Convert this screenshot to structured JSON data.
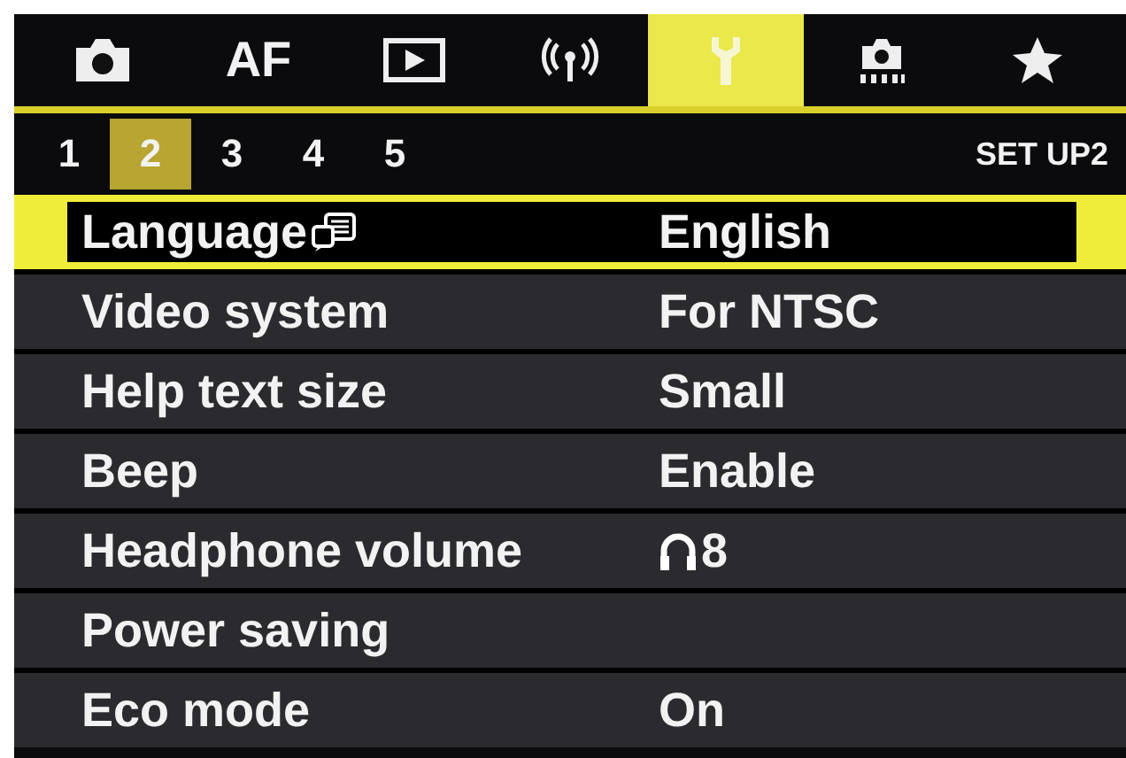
{
  "tabs": [
    {
      "kind": "camera",
      "selected": false
    },
    {
      "kind": "text",
      "label": "AF",
      "selected": false
    },
    {
      "kind": "play",
      "selected": false
    },
    {
      "kind": "wireless",
      "selected": false
    },
    {
      "kind": "wrench",
      "selected": true
    },
    {
      "kind": "custom",
      "selected": false
    },
    {
      "kind": "star",
      "selected": false
    }
  ],
  "pages": [
    {
      "label": "1",
      "selected": false
    },
    {
      "label": "2",
      "selected": true
    },
    {
      "label": "3",
      "selected": false
    },
    {
      "label": "4",
      "selected": false
    },
    {
      "label": "5",
      "selected": false
    }
  ],
  "menu_title": "SET UP2",
  "rows": [
    {
      "kind": "language",
      "label": "Language",
      "value": "English",
      "selected": true
    },
    {
      "kind": "plain",
      "label": "Video system",
      "value": "For NTSC",
      "selected": false
    },
    {
      "kind": "plain",
      "label": "Help text size",
      "value": "Small",
      "selected": false
    },
    {
      "kind": "plain",
      "label": "Beep",
      "value": "Enable",
      "selected": false
    },
    {
      "kind": "volume",
      "label": "Headphone volume",
      "value": "8",
      "selected": false
    },
    {
      "kind": "plain",
      "label": "Power saving",
      "selected": false
    },
    {
      "kind": "plain",
      "label": "Eco mode",
      "value": "On",
      "selected": false
    }
  ]
}
